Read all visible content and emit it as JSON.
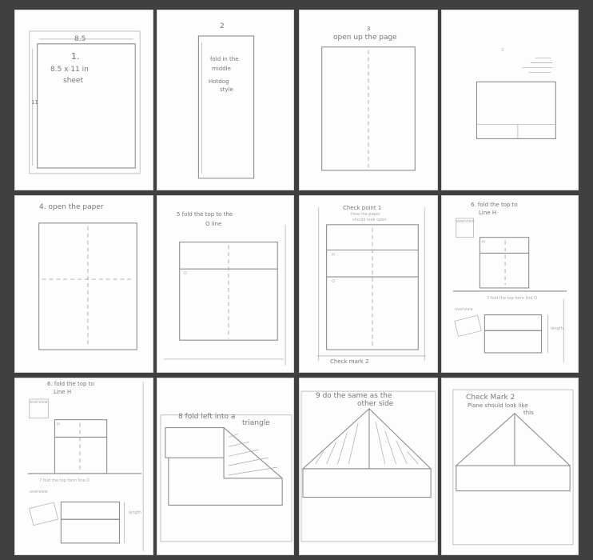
{
  "panels": [
    {
      "title": "1.",
      "dim": "8.5",
      "side": "11",
      "lines": [
        "8.5 x 11 in",
        "sheet"
      ]
    },
    {
      "title": "2",
      "lines": [
        "fold in the",
        "middle",
        "Hotdog",
        "style"
      ]
    },
    {
      "title": "3",
      "subtitle": "open up the page"
    },
    {
      "title": "3"
    },
    {
      "title": "4. open the paper"
    },
    {
      "title": "5 fold the top to the",
      "subtitle": "O line",
      "mark": "O"
    },
    {
      "title": "Check point 1",
      "subtitle": "How the paper",
      "subtitle2": "should look open",
      "mark1": "H",
      "mark2": "O",
      "footer": "Check mark 2"
    },
    {
      "title": "6. fold the top to",
      "subtitle": "Line H",
      "badge": "overview",
      "mark": "H",
      "step7": "7 fold the top form line O",
      "overview": "overview",
      "length": "length"
    },
    {
      "title": "6. fold the top to",
      "subtitle": "Line H",
      "badge": "overview",
      "mark": "H",
      "step7": "7 fold the top form line O",
      "overview": "overview",
      "length": "length"
    },
    {
      "title": "8 fold left into a",
      "subtitle": "triangle"
    },
    {
      "title": "9 do the same as the",
      "subtitle": "other side"
    },
    {
      "title": "Check Mark 2",
      "subtitle": "Plane should look like",
      "subtitle2": "this"
    }
  ]
}
